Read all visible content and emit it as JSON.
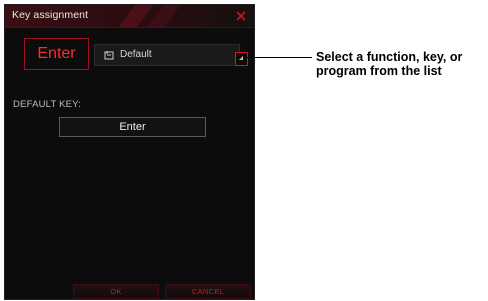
{
  "dialog": {
    "title": "Key assignment",
    "key_preview": "Enter",
    "dropdown_selected": "Default",
    "section_label": "DEFAULT KEY:",
    "default_key_value": "Enter",
    "ok_label": "OK",
    "cancel_label": "CANCEL"
  },
  "callout": {
    "line1": "Select a function, key, or",
    "line2": "program from the list"
  },
  "colors": {
    "accent": "#e3101f",
    "background": "#0c0c0c",
    "key_text": "#ff2a36"
  },
  "icons": {
    "close": "close-icon",
    "dropdown_item": "default-item-icon",
    "dropdown_arrow": "dropdown-arrow-icon"
  }
}
